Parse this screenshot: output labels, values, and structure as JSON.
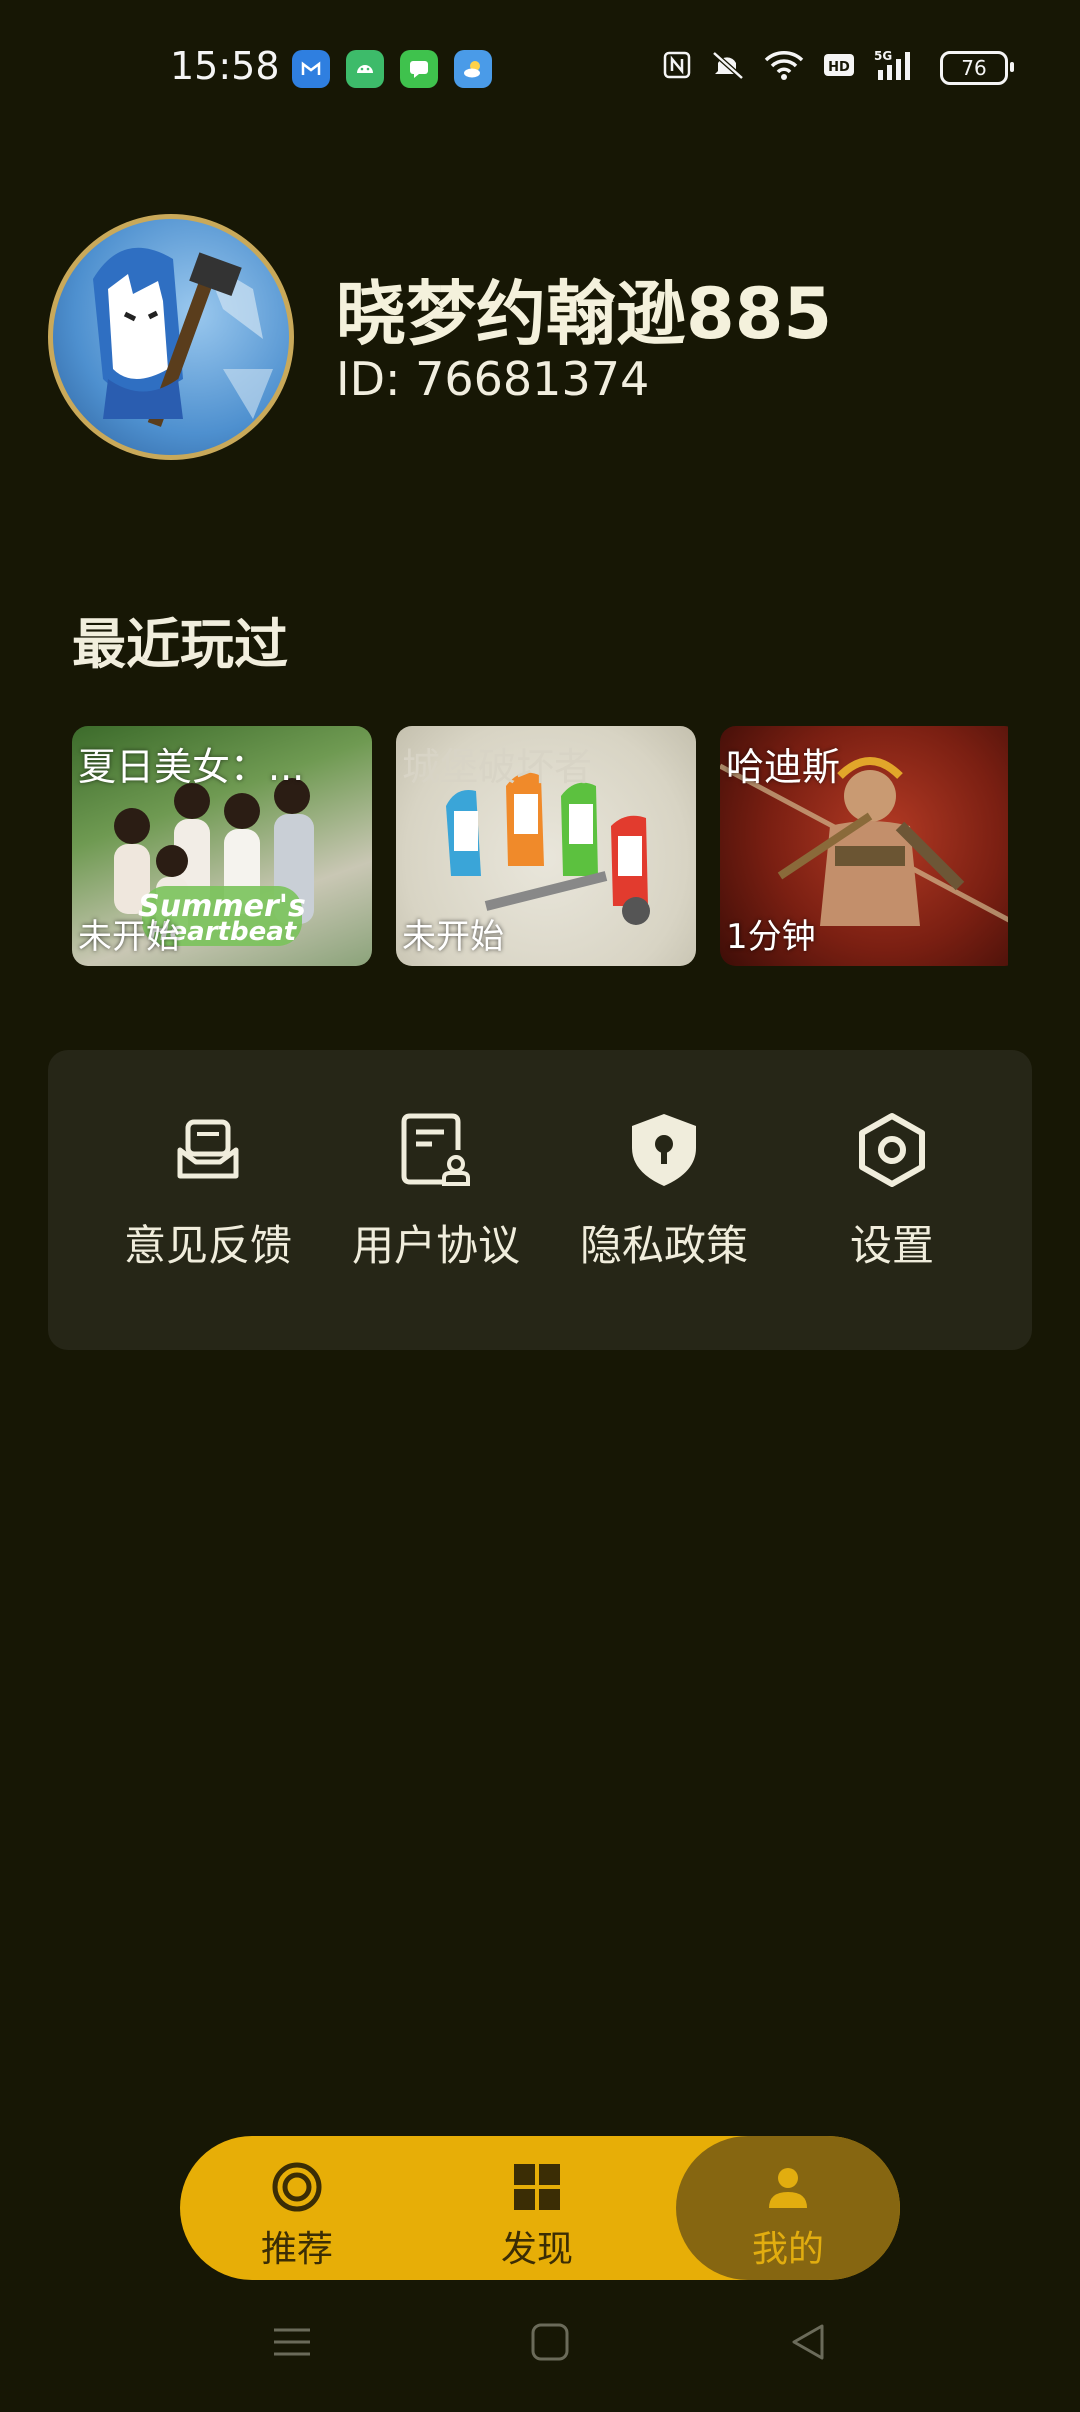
{
  "status_bar": {
    "time": "15:58",
    "notification_icons": [
      {
        "name": "myfun-app-icon",
        "color": "#2f7fe0"
      },
      {
        "name": "android-app-icon",
        "color": "#3dbb6a"
      },
      {
        "name": "messages-app-icon",
        "color": "#3fc24d"
      },
      {
        "name": "weather-app-icon",
        "color": "#4a9be8"
      }
    ],
    "icons": [
      "nfc-icon",
      "mute-icon",
      "wifi-icon",
      "hd-icon",
      "signal-5g-icon"
    ],
    "battery": "76"
  },
  "profile": {
    "username": "晓梦约翰逊885",
    "user_id": "ID: 76681374"
  },
  "recent": {
    "title": "最近玩过",
    "games": [
      {
        "title": "夏日美女：...",
        "status": "未开始"
      },
      {
        "title": "城堡破坏者",
        "status": "未开始"
      },
      {
        "title": "哈迪斯",
        "status": "1分钟"
      }
    ]
  },
  "menu": {
    "items": [
      {
        "label": "意见反馈",
        "icon": "feedback-icon"
      },
      {
        "label": "用户协议",
        "icon": "user-agreement-icon"
      },
      {
        "label": "隐私政策",
        "icon": "privacy-shield-icon"
      },
      {
        "label": "设置",
        "icon": "settings-icon"
      }
    ]
  },
  "tabbar": {
    "tabs": [
      {
        "label": "推荐",
        "icon": "recommend-icon"
      },
      {
        "label": "发现",
        "icon": "discover-grid-icon"
      },
      {
        "label": "我的",
        "icon": "profile-person-icon",
        "active": true
      }
    ],
    "colors": {
      "bar": "#e7ae07",
      "active": "#866611"
    }
  },
  "navbar": {
    "icons": [
      "menu-nav-icon",
      "home-nav-icon",
      "back-nav-icon"
    ]
  }
}
